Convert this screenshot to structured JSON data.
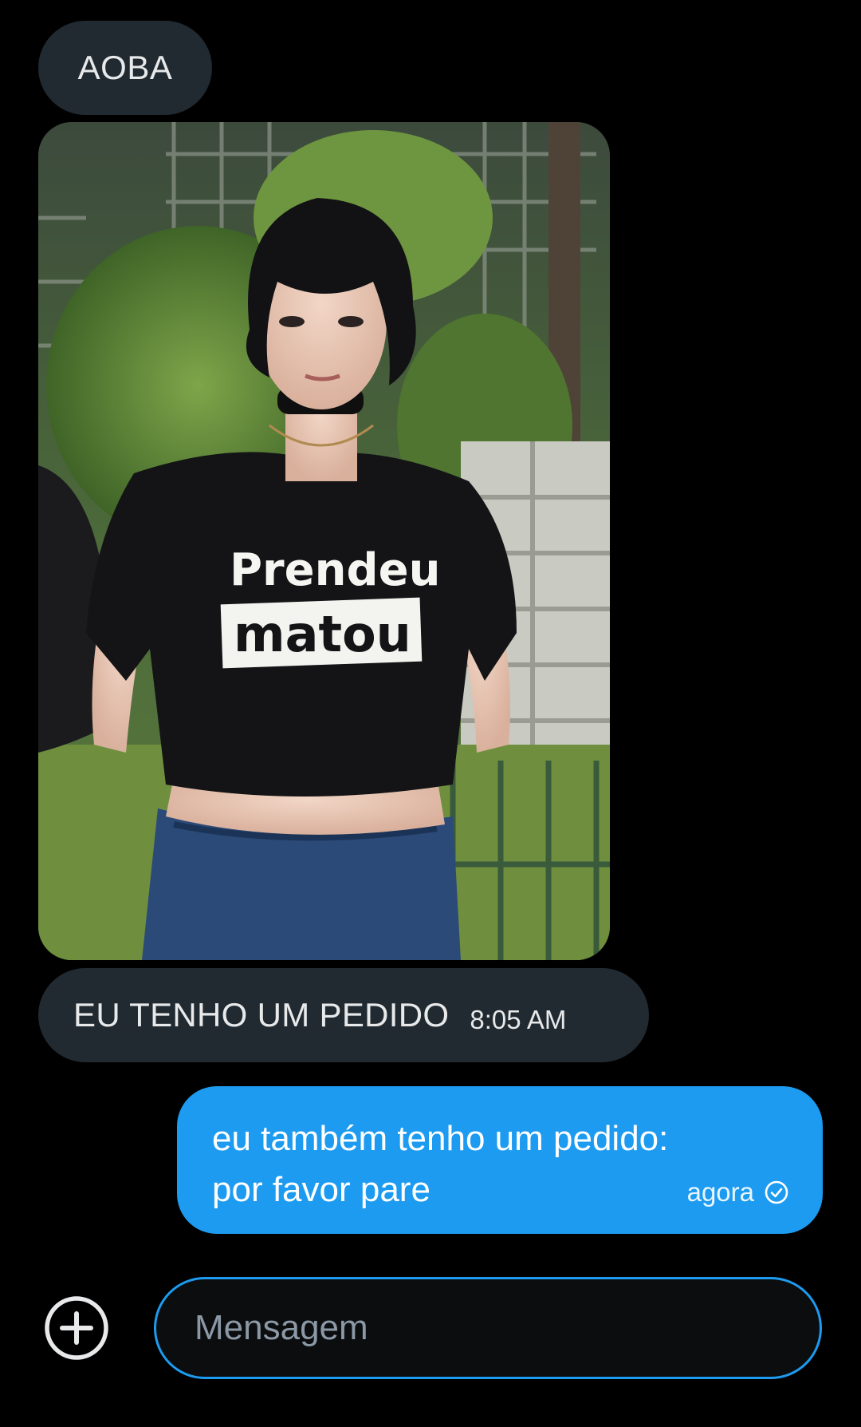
{
  "conversation": {
    "incoming": [
      {
        "text": "AOBA"
      },
      {
        "text": "EU TENHO UM PEDIDO",
        "time": "8:05 AM"
      }
    ],
    "photo": {
      "shirt_line1": "Prendeu",
      "shirt_line2": "matou"
    },
    "outgoing": {
      "line1": "eu também tenho um pedido:",
      "line2": "por favor pare",
      "time": "agora",
      "status_icon": "check-circle-icon"
    }
  },
  "composer": {
    "placeholder": "Mensagem",
    "add_icon": "plus-circle-icon"
  },
  "colors": {
    "background": "#000000",
    "incoming_bubble": "#212a31",
    "outgoing_bubble": "#1d9bf0",
    "accent": "#1d9bf0"
  }
}
